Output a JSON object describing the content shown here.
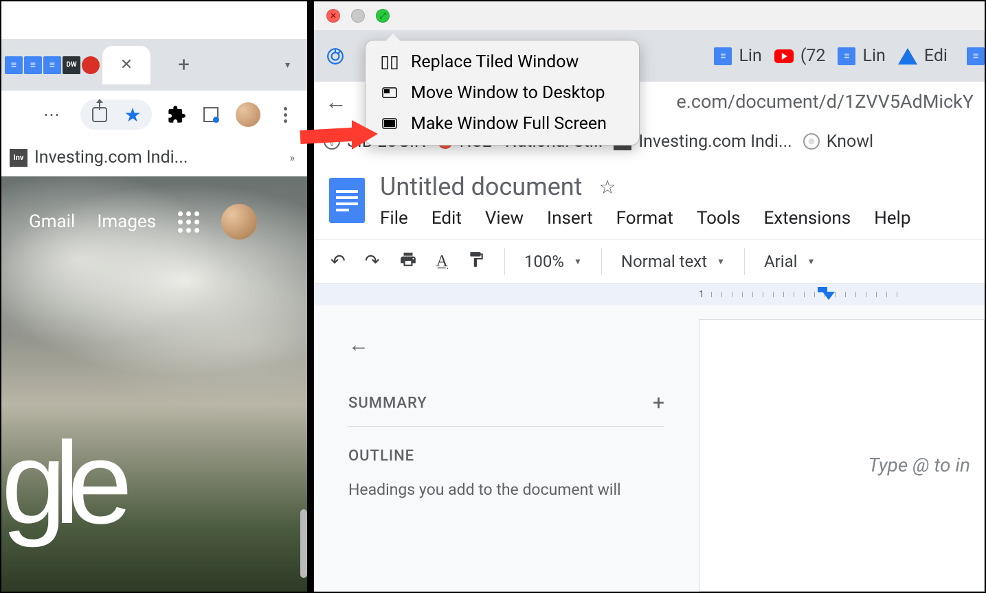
{
  "left": {
    "bookmark_label": "Investing.com Indi...",
    "links": {
      "gmail": "Gmail",
      "images": "Images"
    },
    "logo_fragment": "gle"
  },
  "traffic_menu": {
    "item1": "Replace Tiled Window",
    "item2": "Move Window to Desktop",
    "item3": "Make Window Full Screen"
  },
  "right": {
    "tabs": {
      "lin1": "Lin",
      "yt": "(72",
      "lin2": "Lin",
      "edi": "Edi"
    },
    "url_suffix": "e.com/document/d/1ZVV5AdMickY",
    "bookmarks": {
      "sib": "SIB-LOGIN",
      "nse": "NSE - National St...",
      "inv": "Investing.com Indi...",
      "knowl": "Knowl"
    }
  },
  "docs": {
    "title": "Untitled document",
    "menus": {
      "file": "File",
      "edit": "Edit",
      "view": "View",
      "insert": "Insert",
      "format": "Format",
      "tools": "Tools",
      "extensions": "Extensions",
      "help": "Help"
    },
    "toolbar": {
      "zoom": "100%",
      "style": "Normal text",
      "font": "Arial"
    },
    "ruler_num": "1",
    "outline": {
      "summary": "SUMMARY",
      "outline": "OUTLINE",
      "hint": "Headings you add to the document will"
    },
    "placeholder": "Type @ to in"
  }
}
